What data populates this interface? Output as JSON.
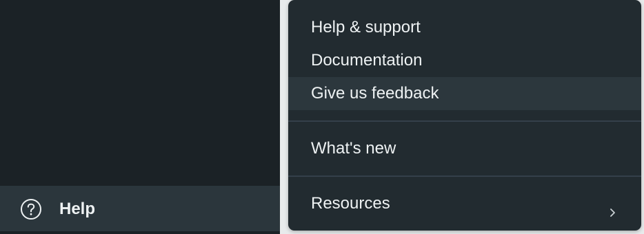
{
  "sidebar": {
    "help_label": "Help"
  },
  "menu": {
    "items": [
      {
        "label": "Help & support"
      },
      {
        "label": "Documentation"
      },
      {
        "label": "Give us feedback"
      },
      {
        "label": "What's new"
      },
      {
        "label": "Resources"
      }
    ]
  },
  "icons": {
    "help": "question-circle-icon",
    "submenu": "chevron-right-icon"
  },
  "colors": {
    "sidebar_bg": "#1b2226",
    "sidebar_active_bg": "#2b363c",
    "menu_bg": "#222b30",
    "menu_hover_bg": "#2c373d",
    "divider": "#34404a",
    "text": "#eef2f3"
  }
}
